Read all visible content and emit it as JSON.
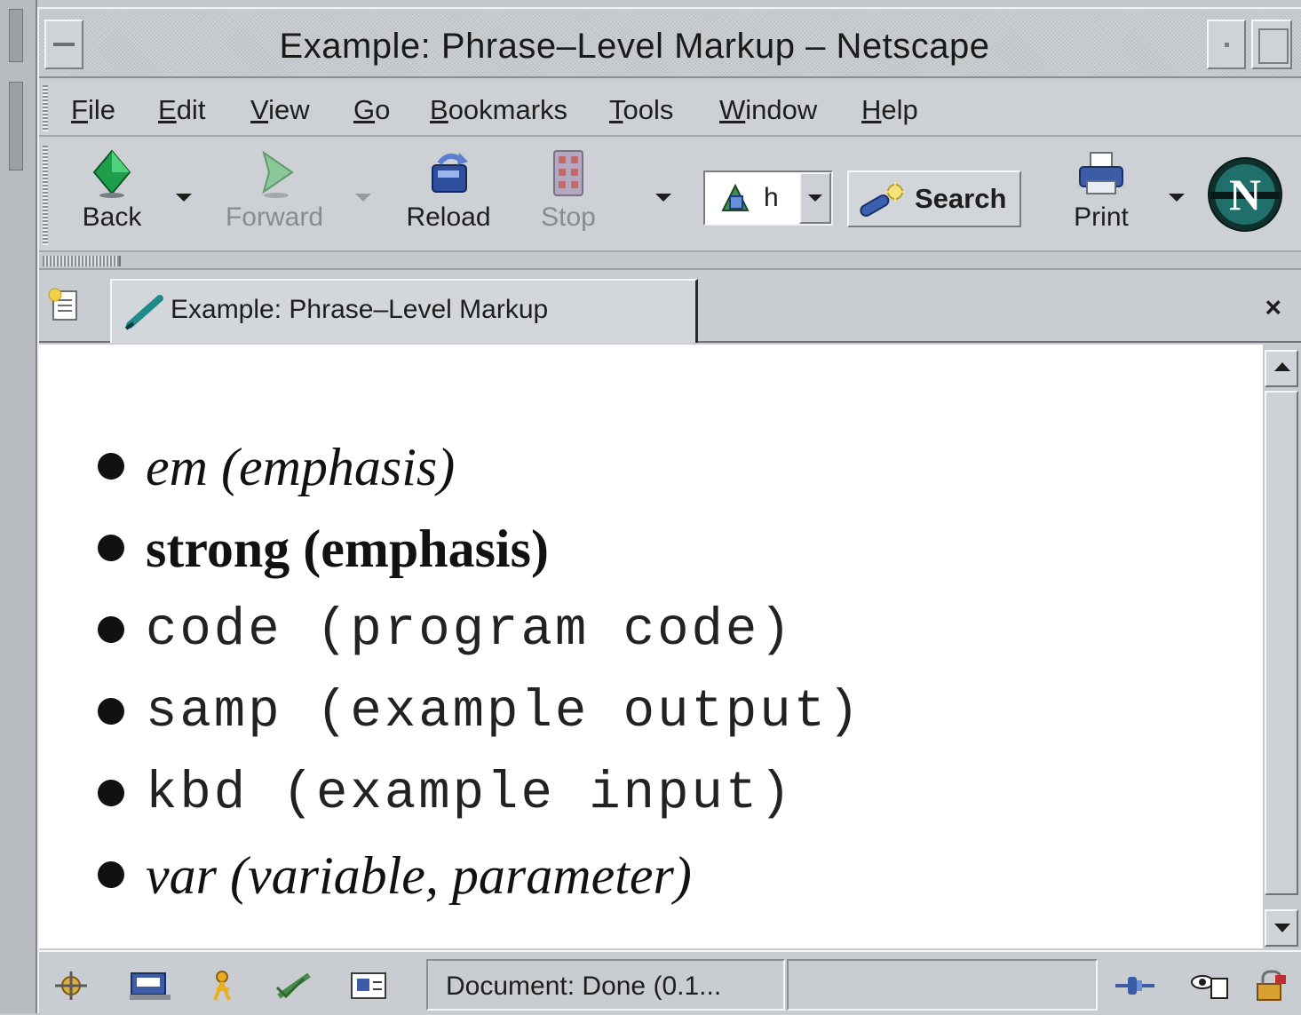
{
  "window": {
    "title": "Example: Phrase–Level Markup – Netscape"
  },
  "menubar": {
    "items": [
      {
        "label": "File",
        "mnemonic": "F",
        "rest": "ile"
      },
      {
        "label": "Edit",
        "mnemonic": "E",
        "rest": "dit"
      },
      {
        "label": "View",
        "mnemonic": "V",
        "rest": "iew"
      },
      {
        "label": "Go",
        "mnemonic": "G",
        "rest": "o"
      },
      {
        "label": "Bookmarks",
        "mnemonic": "B",
        "rest": "ookmarks"
      },
      {
        "label": "Tools",
        "mnemonic": "T",
        "rest": "ools"
      },
      {
        "label": "Window",
        "mnemonic": "W",
        "rest": "indow"
      },
      {
        "label": "Help",
        "mnemonic": "H",
        "rest": "elp"
      }
    ]
  },
  "toolbar": {
    "back_label": "Back",
    "forward_label": "Forward",
    "reload_label": "Reload",
    "stop_label": "Stop",
    "url_value": "h",
    "search_label": "Search",
    "print_label": "Print"
  },
  "tabs": {
    "active_label": "Example: Phrase–Level Markup",
    "close_glyph": "×"
  },
  "content": {
    "items": [
      {
        "text": "em (emphasis)",
        "style": "em"
      },
      {
        "text": "strong (emphasis)",
        "style": "strong"
      },
      {
        "text": "code (program code)",
        "style": "mono"
      },
      {
        "text": "samp (example output)",
        "style": "mono"
      },
      {
        "text": "kbd (example input)",
        "style": "mono"
      },
      {
        "text": "var (variable, parameter)",
        "style": "em"
      }
    ]
  },
  "statusbar": {
    "status_text": "Document: Done (0.1..."
  },
  "colors": {
    "chrome": "#c9cdd1",
    "content_bg": "#ffffff",
    "text": "#111111",
    "netscape_logo": "#1f6f6a"
  },
  "icons": {
    "back": "green-arrow-left-icon",
    "forward": "green-arrow-right-icon",
    "reload": "reload-icon",
    "stop": "stop-icon",
    "search": "search-magnifier-icon",
    "print": "printer-icon",
    "logo": "netscape-logo-icon"
  }
}
